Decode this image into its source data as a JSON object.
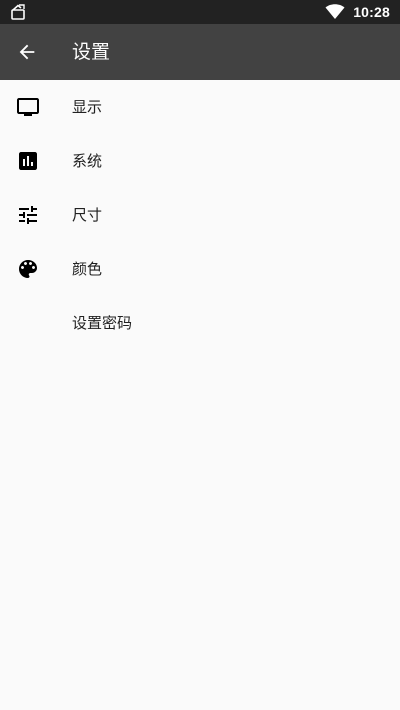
{
  "status_bar": {
    "time": "10:28",
    "left_icon": "app-notification-icon",
    "signal_icon": "wifi-icon"
  },
  "app_bar": {
    "back_icon": "arrow-back-icon",
    "title": "设置"
  },
  "menu": {
    "items": [
      {
        "label": "显示",
        "icon": "monitor-icon"
      },
      {
        "label": "系统",
        "icon": "bar-chart-icon"
      },
      {
        "label": "尺寸",
        "icon": "tune-sliders-icon"
      },
      {
        "label": "颜色",
        "icon": "palette-icon"
      },
      {
        "label": "设置密码",
        "icon": ""
      }
    ]
  },
  "colors": {
    "status_bar_bg": "#222222",
    "app_bar_bg": "#424242",
    "page_bg": "#fafafa",
    "text_primary": "#212121",
    "icon_color": "#000000"
  }
}
